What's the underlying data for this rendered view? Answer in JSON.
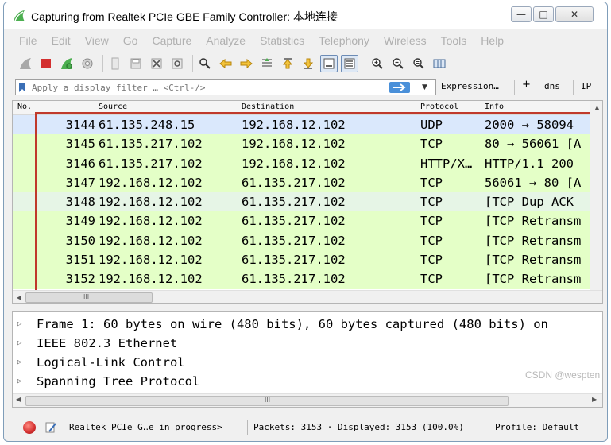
{
  "window": {
    "title": "Capturing from Realtek PCIe GBE Family Controller: 本地连接",
    "min_glyph": "—",
    "max_glyph": "□",
    "close_glyph": "✕"
  },
  "menu": [
    "File",
    "Edit",
    "View",
    "Go",
    "Capture",
    "Analyze",
    "Statistics",
    "Telephony",
    "Wireless",
    "Tools",
    "Help"
  ],
  "filter": {
    "placeholder": "Apply a display filter … <Ctrl-/>",
    "expression_label": "Expression…",
    "plus_label": "+",
    "dns_label": "dns",
    "ip_label": "IP"
  },
  "packet_list": {
    "columns": {
      "no": "No.",
      "source": "Source",
      "destination": "Destination",
      "protocol": "Protocol",
      "info": "Info"
    },
    "rows": [
      {
        "no": "3144",
        "source": "61.135.248.15",
        "destination": "192.168.12.102",
        "protocol": "UDP",
        "info": "2000 → 58094",
        "bg": "#dae8fc"
      },
      {
        "no": "3145",
        "source": "61.135.217.102",
        "destination": "192.168.12.102",
        "protocol": "TCP",
        "info": "80 → 56061 [A",
        "bg": "#e4ffc7"
      },
      {
        "no": "3146",
        "source": "61.135.217.102",
        "destination": "192.168.12.102",
        "protocol": "HTTP/X…",
        "info": "HTTP/1.1 200",
        "bg": "#e4ffc7"
      },
      {
        "no": "3147",
        "source": "192.168.12.102",
        "destination": "61.135.217.102",
        "protocol": "TCP",
        "info": "56061 → 80 [A",
        "bg": "#e4ffc7"
      },
      {
        "no": "3148",
        "source": "192.168.12.102",
        "destination": "61.135.217.102",
        "protocol": "TCP",
        "info": "[TCP Dup ACK",
        "bg": "#e6f5e6"
      },
      {
        "no": "3149",
        "source": "192.168.12.102",
        "destination": "61.135.217.102",
        "protocol": "TCP",
        "info": "[TCP Retransm",
        "bg": "#e4ffc7"
      },
      {
        "no": "3150",
        "source": "192.168.12.102",
        "destination": "61.135.217.102",
        "protocol": "TCP",
        "info": "[TCP Retransm",
        "bg": "#e4ffc7"
      },
      {
        "no": "3151",
        "source": "192.168.12.102",
        "destination": "61.135.217.102",
        "protocol": "TCP",
        "info": "[TCP Retransm",
        "bg": "#e4ffc7"
      },
      {
        "no": "3152",
        "source": "192.168.12.102",
        "destination": "61.135.217.102",
        "protocol": "TCP",
        "info": "[TCP Retransm",
        "bg": "#e4ffc7"
      }
    ],
    "highlight_color": "#c0392b",
    "scroll_grip": "III"
  },
  "details": {
    "items": [
      "Frame 1: 60 bytes on wire (480 bits), 60 bytes captured (480 bits) on",
      "IEEE 802.3 Ethernet",
      "Logical-Link Control",
      "Spanning Tree Protocol"
    ],
    "expand_glyph": "▷",
    "scroll_grip": "III",
    "watermark": "CSDN @wespten"
  },
  "status": {
    "capture": "Realtek PCIe G‥e in progress>",
    "packets": "Packets: 3153 · Displayed: 3153 (100.0%)",
    "profile": "Profile: Default"
  },
  "colors": {
    "udp_row": "#dae8fc",
    "tcp_row": "#e4ffc7",
    "record_red": "#d32f2f",
    "apply_blue": "#4a90d9"
  }
}
